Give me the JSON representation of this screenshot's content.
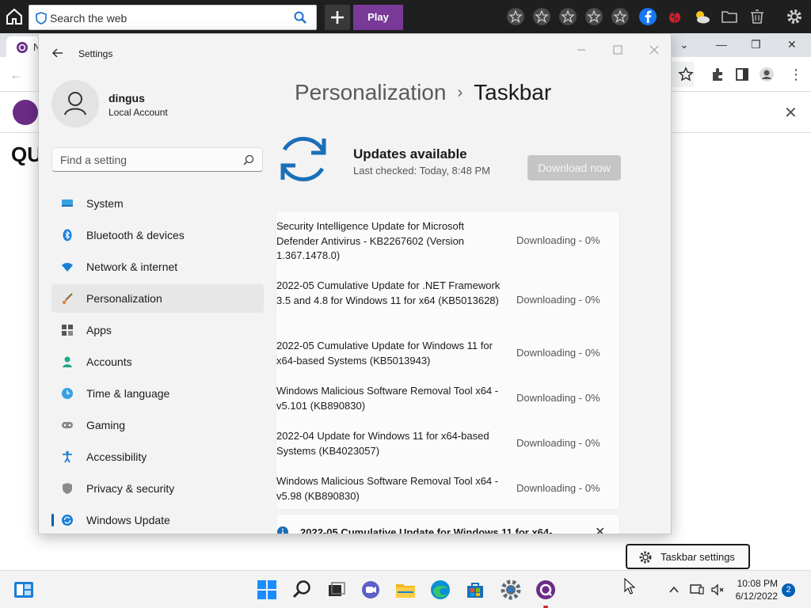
{
  "topbar": {
    "search_placeholder": "Search the web",
    "play_label": "Play"
  },
  "browser": {
    "tab_title": "N",
    "page_letters": "QU"
  },
  "settings": {
    "app_title": "Settings",
    "user": {
      "name": "dingus",
      "account_type": "Local Account"
    },
    "find_placeholder": "Find a setting",
    "nav": [
      {
        "label": "System",
        "icon": "system-icon"
      },
      {
        "label": "Bluetooth & devices",
        "icon": "bluetooth-icon"
      },
      {
        "label": "Network & internet",
        "icon": "wifi-icon"
      },
      {
        "label": "Personalization",
        "icon": "brush-icon",
        "active": true
      },
      {
        "label": "Apps",
        "icon": "apps-icon"
      },
      {
        "label": "Accounts",
        "icon": "person-icon"
      },
      {
        "label": "Time & language",
        "icon": "globe-clock-icon"
      },
      {
        "label": "Gaming",
        "icon": "gamepad-icon"
      },
      {
        "label": "Accessibility",
        "icon": "accessibility-icon"
      },
      {
        "label": "Privacy & security",
        "icon": "shield-icon"
      },
      {
        "label": "Windows Update",
        "icon": "windows-update-icon"
      }
    ],
    "breadcrumb": {
      "parent": "Personalization",
      "separator": "›",
      "current": "Taskbar"
    },
    "updates": {
      "title": "Updates available",
      "last_checked": "Last checked: Today, 8:48 PM",
      "download_label": "Download now",
      "items": [
        {
          "name": "Security Intelligence Update for Microsoft Defender Antivirus - KB2267602 (Version 1.367.1478.0)",
          "status": "Downloading - 0%"
        },
        {
          "name": "2022-05 Cumulative Update for .NET Framework 3.5 and 4.8 for Windows 11 for x64 (KB5013628)",
          "status": "Downloading - 0%"
        },
        {
          "name": "2022-05 Cumulative Update for Windows 11 for x64-based Systems (KB5013943)",
          "status": "Downloading - 0%"
        },
        {
          "name": "Windows Malicious Software Removal Tool x64 - v5.101 (KB890830)",
          "status": "Downloading - 0%"
        },
        {
          "name": "2022-04 Update for Windows 11 for x64-based Systems (KB4023057)",
          "status": "Downloading - 0%"
        },
        {
          "name": "Windows Malicious Software Removal Tool x64 - v5.98 (KB890830)",
          "status": "Downloading - 0%"
        }
      ],
      "notice": "2022-05 Cumulative Update for Windows 11 for x64-"
    }
  },
  "tooltip": {
    "label": "Taskbar settings"
  },
  "taskbar": {
    "time": "10:08 PM",
    "date": "6/12/2022",
    "notification_count": "2"
  },
  "colors": {
    "accent": "#005fb8",
    "play_purple": "#7a3a99",
    "sync_blue": "#1a6fb8"
  }
}
